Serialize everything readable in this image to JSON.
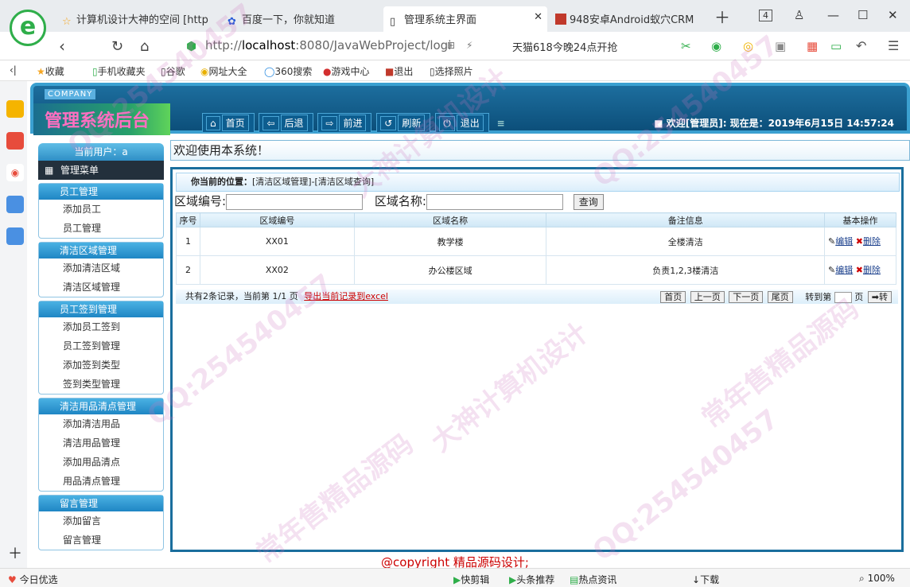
{
  "browser": {
    "logo_letter": "e",
    "tabs": [
      {
        "title": "计算机设计大神的空间 [http"
      },
      {
        "title": "百度一下，你就知道"
      },
      {
        "title": "管理系统主界面"
      },
      {
        "title": "948安卓Android蚁穴CRM"
      }
    ],
    "tab_count": "4",
    "url_prefix": "http://",
    "url_domain": "localhost",
    "url_rest": ":8080/JavaWebProject/logi",
    "promo": "天猫618今晚24点开抢",
    "bookmarks": [
      "收藏",
      "手机收藏夹",
      "谷歌",
      "网址大全",
      "360搜索",
      "游戏中心",
      "退出",
      "选择照片"
    ],
    "status_left": "今日优选",
    "status_items": [
      "快剪辑",
      "头条推荐",
      "热点资讯",
      "下载"
    ],
    "zoom": "100%"
  },
  "app": {
    "company": "COMPANY",
    "title": "管理系统后台",
    "nav": [
      "首页",
      "后退",
      "前进",
      "刷新",
      "退出"
    ],
    "welcome": "欢迎[管理员]:  现在是：2019年6月15日 14:57:24",
    "current_user": "当前用户：a",
    "menu_title": "管理菜单",
    "welcome_bar": "欢迎使用本系统！",
    "groups": [
      {
        "title": "员工管理",
        "items": [
          "添加员工",
          "员工管理"
        ]
      },
      {
        "title": "清洁区域管理",
        "items": [
          "添加清洁区域",
          "清洁区域管理"
        ]
      },
      {
        "title": "员工签到管理",
        "items": [
          "添加员工签到",
          "员工签到管理",
          "添加签到类型",
          "签到类型管理"
        ]
      },
      {
        "title": "清洁用品清点管理",
        "items": [
          "添加清洁用品",
          "清洁用品管理",
          "添加用品清点",
          "用品清点管理"
        ]
      },
      {
        "title": "留言管理",
        "items": [
          "添加留言",
          "留言管理"
        ]
      }
    ],
    "position_label": "你当前的位置：",
    "position_path": "[清洁区域管理]-[清洁区域查询]",
    "search": {
      "code_label": "区域编号:",
      "name_label": "区域名称:",
      "button": "查询"
    },
    "table": {
      "headers": [
        "序号",
        "区域编号",
        "区域名称",
        "备注信息",
        "基本操作"
      ],
      "rows": [
        [
          "1",
          "XX01",
          "教学楼",
          "全楼清洁"
        ],
        [
          "2",
          "XX02",
          "办公楼区域",
          "负责1,2,3楼清洁"
        ]
      ],
      "edit_label": "编辑",
      "delete_label": "删除"
    },
    "pager": {
      "summary": "共有2条记录，当前第 1/1 页",
      "export": "导出当前记录到excel",
      "buttons": [
        "首页",
        "上一页",
        "下一页",
        "尾页"
      ],
      "goto": "转到第",
      "page_unit": "页",
      "go": "转"
    },
    "footer": "@copyright 精品源码设计;"
  },
  "watermarks": [
    "QQ:254540457",
    "大神计算机设计",
    "常年售精品源码"
  ]
}
